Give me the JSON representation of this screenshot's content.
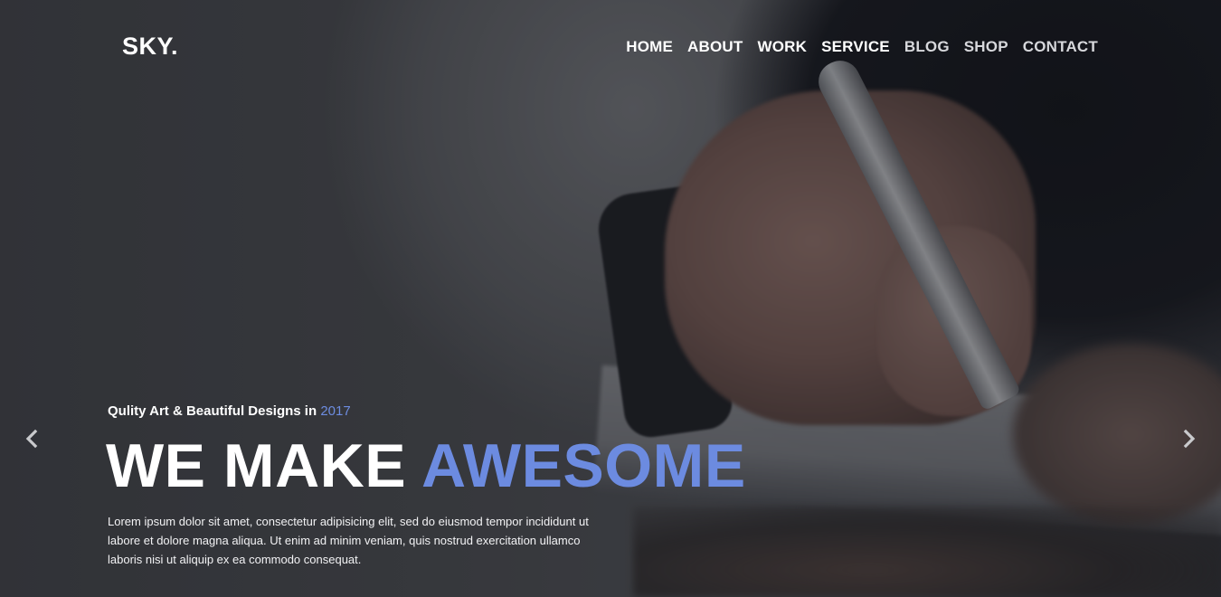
{
  "brand": {
    "logo": "SKY."
  },
  "nav": {
    "items": [
      {
        "label": "HOME"
      },
      {
        "label": "ABOUT"
      },
      {
        "label": "WORK"
      },
      {
        "label": "SERVICE"
      },
      {
        "label": "BLOG"
      },
      {
        "label": "SHOP"
      },
      {
        "label": "CONTACT"
      }
    ]
  },
  "slide": {
    "kicker_text": "Qulity Art & Beautiful Designs in",
    "kicker_year": "2017",
    "headline_main": "WE MAKE",
    "headline_accent": "AWESOME",
    "description": "Lorem ipsum dolor sit amet, consectetur adipisicing elit, sed do eiusmod tempor incididunt ut labore et dolore magna aliqua. Ut enim ad minim veniam, quis nostrud exercitation ullamco laboris nisi ut aliquip ex ea commodo consequat."
  },
  "controls": {
    "prev_icon": "chevron-left-icon",
    "next_icon": "chevron-right-icon"
  },
  "colors": {
    "accent": "#6c8be0",
    "text": "#ffffff"
  }
}
